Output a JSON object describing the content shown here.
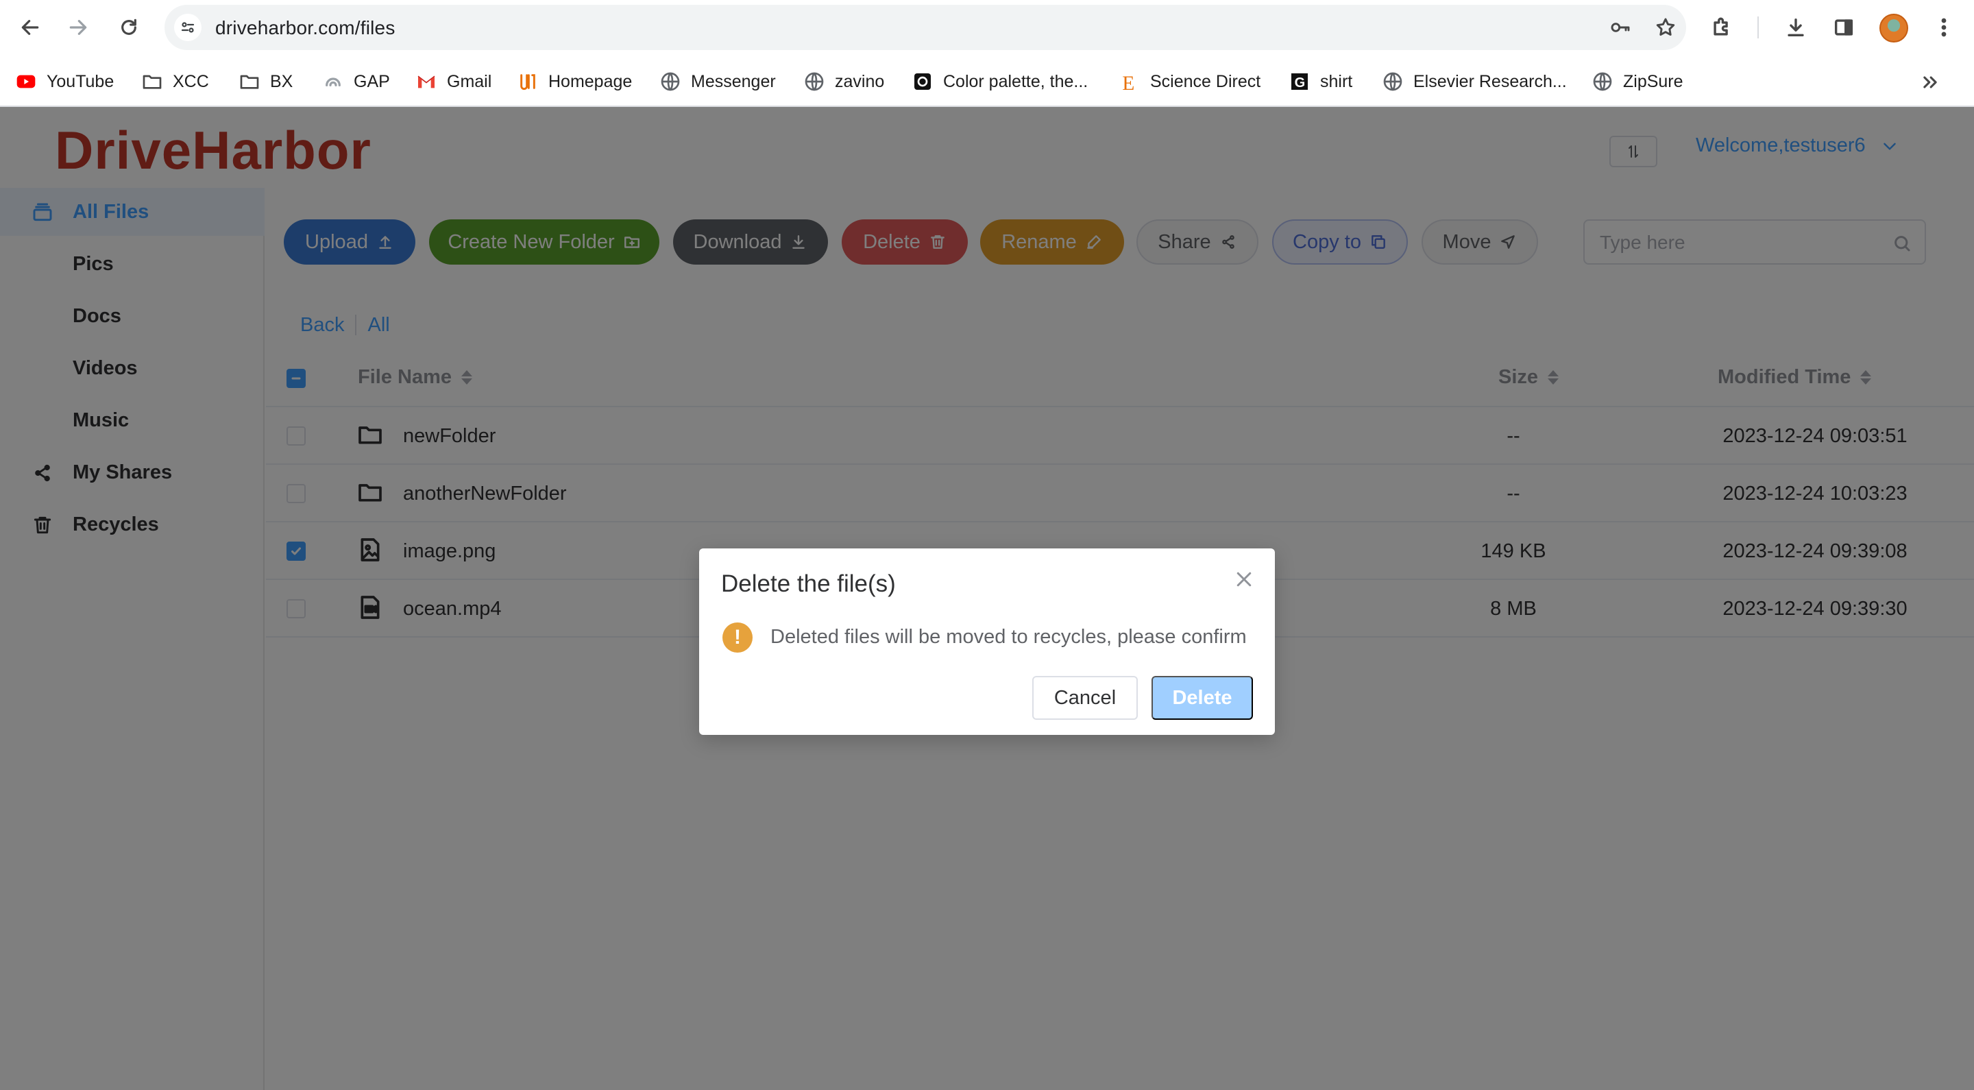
{
  "browser": {
    "url": "driveharbor.com/files",
    "bookmarks": [
      {
        "label": "YouTube",
        "icon": "youtube-icon"
      },
      {
        "label": "XCC",
        "icon": "folder-icon"
      },
      {
        "label": "BX",
        "icon": "folder-icon"
      },
      {
        "label": "GAP",
        "icon": "gap-icon"
      },
      {
        "label": "Gmail",
        "icon": "gmail-icon"
      },
      {
        "label": "Homepage",
        "icon": "homepage-icon"
      },
      {
        "label": "Messenger",
        "icon": "globe-icon"
      },
      {
        "label": "zavino",
        "icon": "globe-icon"
      },
      {
        "label": "Color palette, the...",
        "icon": "color-palette-icon"
      },
      {
        "label": "Science Direct",
        "icon": "elsevier-e-icon"
      },
      {
        "label": "shirt",
        "icon": "shirt-g-icon"
      },
      {
        "label": "Elsevier Research...",
        "icon": "globe-icon"
      },
      {
        "label": "ZipSure",
        "icon": "globe-icon"
      }
    ]
  },
  "app": {
    "logo": "DriveHarbor",
    "welcome": "Welcome,testuser6"
  },
  "sidebar": {
    "items": [
      {
        "label": "All Files",
        "icon": "stack-icon",
        "active": true
      },
      {
        "label": "Pics"
      },
      {
        "label": "Docs"
      },
      {
        "label": "Videos"
      },
      {
        "label": "Music"
      },
      {
        "label": "My Shares",
        "icon": "share-icon"
      },
      {
        "label": "Recycles",
        "icon": "trash-icon"
      }
    ]
  },
  "toolbar": {
    "upload": "Upload",
    "create_folder": "Create New Folder",
    "download": "Download",
    "delete": "Delete",
    "rename": "Rename",
    "share": "Share",
    "copy_to": "Copy to",
    "move": "Move",
    "search_placeholder": "Type here"
  },
  "breadcrumb": {
    "back": "Back",
    "all": "All"
  },
  "table": {
    "headers": {
      "name": "File Name",
      "size": "Size",
      "time": "Modified Time"
    },
    "rows": [
      {
        "name": "newFolder",
        "type": "folder",
        "size": "--",
        "time": "2023-12-24 09:03:51",
        "checked": false
      },
      {
        "name": "anotherNewFolder",
        "type": "folder",
        "size": "--",
        "time": "2023-12-24 10:03:23",
        "checked": false
      },
      {
        "name": "image.png",
        "type": "image",
        "size": "149 KB",
        "time": "2023-12-24 09:39:08",
        "checked": true
      },
      {
        "name": "ocean.mp4",
        "type": "video",
        "size": "8 MB",
        "time": "2023-12-24 09:39:30",
        "checked": false
      }
    ]
  },
  "dialog": {
    "title": "Delete the file(s)",
    "message": "Deleted files will be moved to recycles, please confirm",
    "cancel": "Cancel",
    "confirm": "Delete"
  },
  "colors": {
    "logo": "#c0392b",
    "upload": "#3a7bd5",
    "create_folder": "#5aa02c",
    "download": "#5f6368",
    "delete": "#e05a5a",
    "rename": "#e09d2a",
    "primary": "#409eff",
    "warning": "#e6a23c"
  }
}
